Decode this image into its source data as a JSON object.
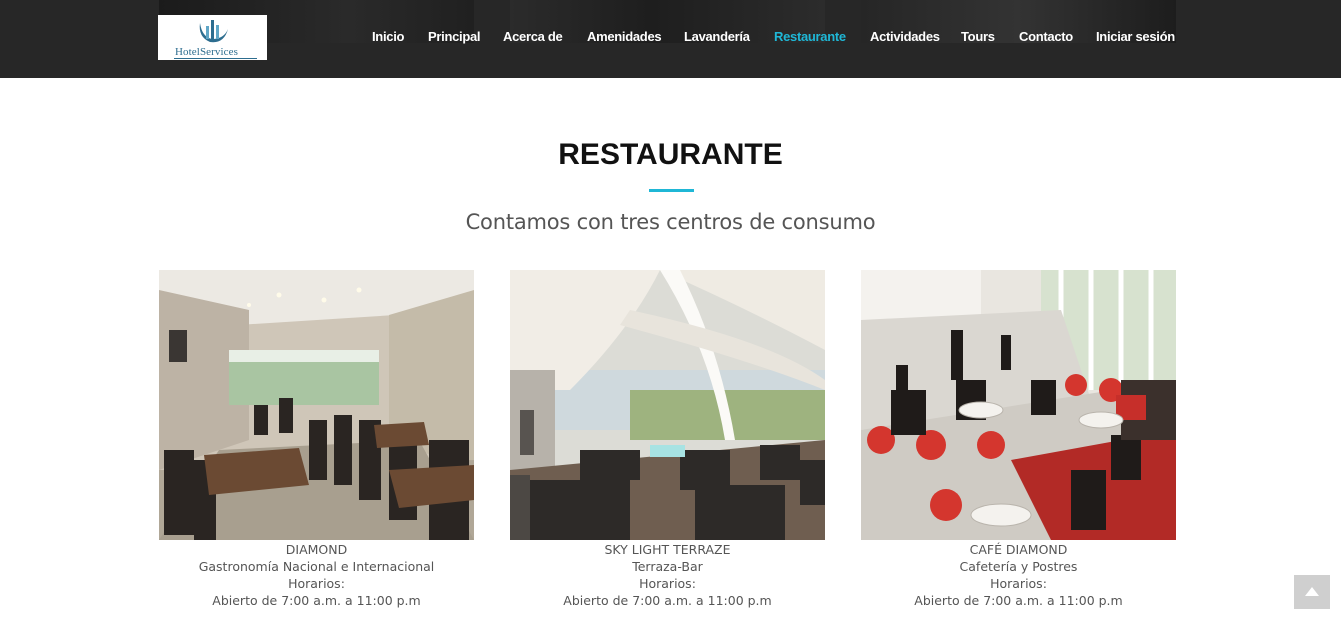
{
  "brand": {
    "logo_text": "HotelServices"
  },
  "nav": {
    "items": [
      {
        "label": "Inicio"
      },
      {
        "label": "Principal"
      },
      {
        "label": "Acerca de"
      },
      {
        "label": "Amenidades"
      },
      {
        "label": "Lavandería"
      },
      {
        "label": "Restaurante",
        "active": true
      },
      {
        "label": "Actividades"
      },
      {
        "label": "Tours"
      },
      {
        "label": "Contacto"
      },
      {
        "label": "Iniciar sesión"
      }
    ]
  },
  "section": {
    "title": "RESTAURANTE",
    "subtitle": "Contamos con tres centros de consumo"
  },
  "restaurants": [
    {
      "name": "DIAMOND",
      "type": "Gastronomía Nacional e Internacional",
      "hours_label": "Horarios:",
      "hours": "Abierto de 7:00 a.m. a 11:00 p.m"
    },
    {
      "name": "SKY LIGHT TERRAZE",
      "type": "Terraza-Bar",
      "hours_label": "Horarios:",
      "hours": "Abierto de 7:00 a.m. a 11:00 p.m"
    },
    {
      "name": "CAFÉ DIAMOND",
      "type": "Cafetería y Postres",
      "hours_label": "Horarios:",
      "hours": "Abierto de 7:00 a.m. a 11:00 p.m"
    }
  ],
  "scroll_top": {
    "icon": "chevron-up-icon"
  },
  "colors": {
    "accent": "#1fb7d6",
    "header_bg": "#272727",
    "logo_blue": "#2d6d8f"
  }
}
